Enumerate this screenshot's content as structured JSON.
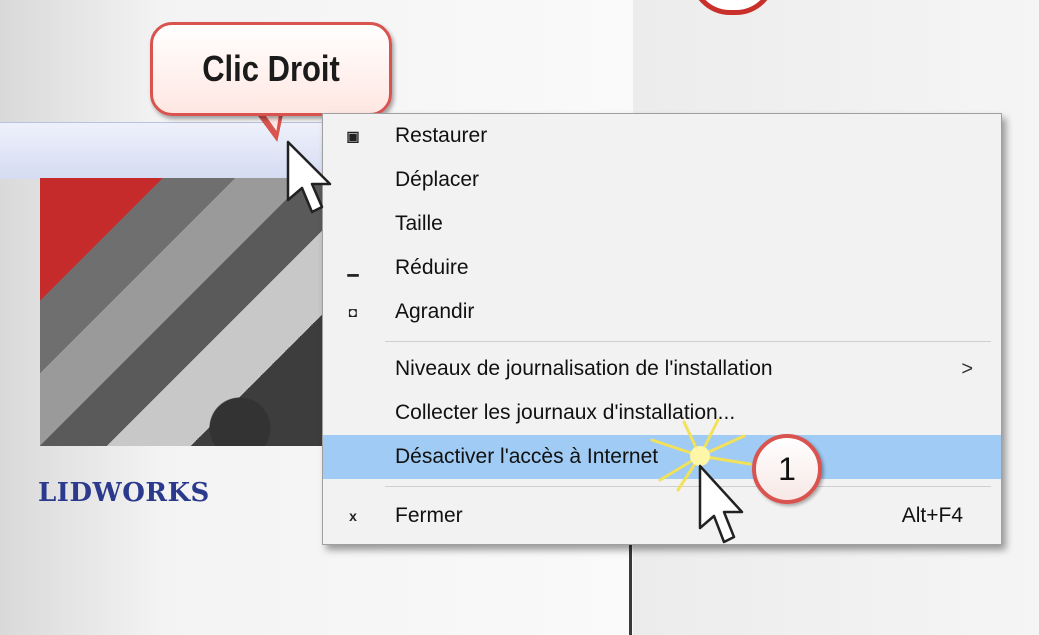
{
  "callout": {
    "label": "Clic Droit"
  },
  "brand": {
    "text": "LIDWORKS"
  },
  "menu": {
    "items": [
      {
        "label": "Restaurer",
        "icon": "restore-icon",
        "icon_glyph": "▣"
      },
      {
        "label": "Déplacer",
        "icon": "",
        "icon_glyph": ""
      },
      {
        "label": "Taille",
        "icon": "",
        "icon_glyph": ""
      },
      {
        "label": "Réduire",
        "icon": "minimize-icon",
        "icon_glyph": "▁"
      },
      {
        "label": "Agrandir",
        "icon": "maximize-icon",
        "icon_glyph": "◘"
      },
      {
        "label": "Niveaux de journalisation de l'installation",
        "submenu_arrow": ">"
      },
      {
        "label": "Collecter les journaux d'installation..."
      },
      {
        "label": "Désactiver l'accès à Internet",
        "highlighted": true
      },
      {
        "label": "Fermer",
        "icon": "close-icon",
        "icon_glyph": "x",
        "shortcut": "Alt+F4"
      }
    ]
  },
  "badge": {
    "number": "1"
  },
  "colors": {
    "highlight": "#9fcbf4",
    "callout_border": "#d9534f",
    "brand_text": "#2b3a8c"
  }
}
